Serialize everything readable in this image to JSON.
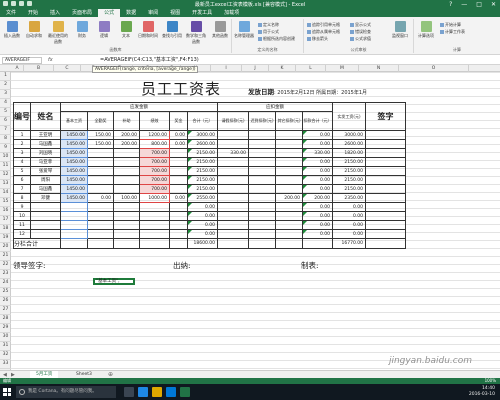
{
  "window": {
    "title": "最新员工excel工资表模板.xls [兼容模式] - Excel",
    "controls": [
      "?",
      "—",
      "□",
      "✕"
    ]
  },
  "tabs": [
    "文件",
    "开始",
    "插入",
    "页面布局",
    "公式",
    "数据",
    "审阅",
    "视图",
    "开发工具",
    "加载项"
  ],
  "active_tab": "公式",
  "ribbon": {
    "groups": {
      "function_library": "函数库",
      "defined_names": "定义的名称",
      "formula_auditing": "公式审核",
      "calculation": "计算"
    },
    "buttons": {
      "insert_function": "插入函数",
      "autosum": "自动求和",
      "recent": "最近使用的函数",
      "financial": "财务",
      "logical": "逻辑",
      "text": "文本",
      "date_time": "日期和时间",
      "lookup": "查找与引用",
      "math": "数学和三角函数",
      "more": "其他函数",
      "name_manager": "名称管理器",
      "watch": "监视窗口",
      "calc_options": "计算选项"
    },
    "small_buttons": {
      "define_name": "定义名称",
      "use_in_formula": "用于公式",
      "create_from_sel": "根据所选内容创建",
      "trace_precedents": "追踪引用单元格",
      "trace_dependents": "追踪从属单元格",
      "remove_arrows": "移去箭头",
      "show_formulas": "显示公式",
      "error_checking": "错误检查",
      "evaluate": "公式求值",
      "calc_now": "开始计算",
      "calc_sheet": "计算工作表"
    }
  },
  "formula_bar": {
    "name_box": "AVERAGEIF",
    "fx": "fx",
    "formula": "=AVERAGEIF(C4:C13,\"基本工资\",F4:F13)",
    "tooltip": "AVERAGEIF(range, criteria, [average_range])"
  },
  "columns": [
    "A",
    "B",
    "C",
    "D",
    "E",
    "F",
    "G",
    "H",
    "I",
    "J",
    "K",
    "L",
    "M",
    "N",
    "O"
  ],
  "rows": [
    "1",
    "2",
    "3",
    "4",
    "5",
    "6",
    "7",
    "8",
    "9",
    "10",
    "11",
    "12",
    "13",
    "14",
    "15",
    "16",
    "17",
    "18",
    "19",
    "20",
    "21",
    "22",
    "23",
    "24",
    "25",
    "26",
    "27",
    "28",
    "29",
    "30",
    "31",
    "32",
    "33"
  ],
  "sheet": {
    "title": "员工工资表",
    "issue_label": "发放日期",
    "issue_text": ": 2015年2月12日  所属日期：2015年1月",
    "header": {
      "no": "编号",
      "name": "姓名",
      "payable": "应发金额",
      "deduct": "应扣金额",
      "net": "实发工资(元)",
      "sign": "签字",
      "sub": [
        "基本工资",
        "全勤奖",
        "补助",
        "绩效",
        "奖金",
        "合计（元）",
        "请假扣款(元)",
        "迟到扣款(元)",
        "其它扣款(元)",
        "扣款合计（元）"
      ]
    },
    "rows": [
      {
        "no": "1",
        "name": "王亚明",
        "cells": [
          "1450.00",
          "150.00",
          "200.00",
          "1200.00",
          "0.00",
          "3000.00",
          "",
          "",
          "",
          "0.00",
          "3000.00",
          ""
        ]
      },
      {
        "no": "2",
        "name": "马国鑫",
        "cells": [
          "1450.00",
          "150.00",
          "200.00",
          "800.00",
          "0.00",
          "2600.00",
          "",
          "",
          "",
          "0.00",
          "2600.00",
          ""
        ]
      },
      {
        "no": "3",
        "name": "刘国晓",
        "cells": [
          "1450.00",
          "",
          "",
          "700.00",
          "",
          "2150.00",
          "330.00",
          "",
          "",
          "330.00",
          "1820.00",
          ""
        ]
      },
      {
        "no": "4",
        "name": "马亚菲",
        "cells": [
          "1450.00",
          "",
          "",
          "700.00",
          "",
          "2150.00",
          "",
          "",
          "",
          "0.00",
          "2150.00",
          ""
        ]
      },
      {
        "no": "5",
        "name": "张爱琴",
        "cells": [
          "1450.00",
          "",
          "",
          "700.00",
          "",
          "2150.00",
          "",
          "",
          "",
          "0.00",
          "2150.00",
          ""
        ]
      },
      {
        "no": "6",
        "name": "周阳",
        "cells": [
          "1450.00",
          "",
          "",
          "700.00",
          "",
          "2150.00",
          "",
          "",
          "",
          "0.00",
          "2150.00",
          ""
        ]
      },
      {
        "no": "7",
        "name": "马国鑫",
        "cells": [
          "1450.00",
          "",
          "",
          "700.00",
          "",
          "2150.00",
          "",
          "",
          "",
          "0.00",
          "2150.00",
          ""
        ]
      },
      {
        "no": "8",
        "name": "邓健",
        "cells": [
          "1450.00",
          "0.00",
          "100.00",
          "1000.00",
          "0.00",
          "2550.00",
          "",
          "",
          "200.00",
          "200.00",
          "2350.00",
          ""
        ]
      },
      {
        "no": "9",
        "name": "",
        "cells": [
          "",
          "",
          "",
          "",
          "",
          "0.00",
          "",
          "",
          "",
          "0.00",
          "0.00",
          ""
        ]
      },
      {
        "no": "10",
        "name": "",
        "cells": [
          "",
          "",
          "",
          "",
          "",
          "0.00",
          "",
          "",
          "",
          "0.00",
          "0.00",
          ""
        ]
      },
      {
        "no": "11",
        "name": "",
        "cells": [
          "",
          "",
          "",
          "",
          "",
          "0.00",
          "",
          "",
          "",
          "0.00",
          "0.00",
          ""
        ]
      },
      {
        "no": "12",
        "name": "",
        "cells": [
          "",
          "",
          "",
          "",
          "",
          "0.00",
          "",
          "",
          "",
          "0.00",
          "0.00",
          ""
        ]
      }
    ],
    "total": {
      "label": "分栏合计",
      "sum": "18600.00",
      "net": "16770.00"
    },
    "signatures": {
      "leader": "领导签字:",
      "cashier": "出纳:",
      "maker": "制表:"
    },
    "active_cell": "\"基本工资\","
  },
  "sheet_tabs": [
    "5月工资",
    "Sheet3"
  ],
  "active_sheet": "5月工资",
  "status": {
    "mode": "编辑",
    "zoom": "100%"
  },
  "taskbar": {
    "search": "我是 Cortana。有问题尽管问我。",
    "time": "14:40",
    "date": "2016-03-10"
  },
  "watermark": "jingyan.baidu.com"
}
